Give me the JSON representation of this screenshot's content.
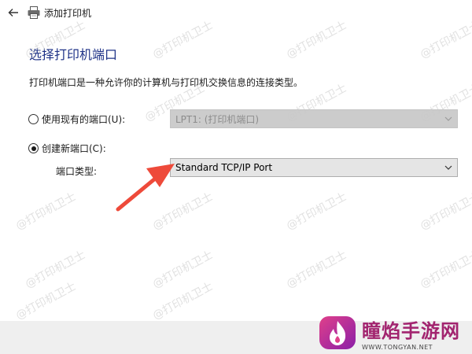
{
  "window": {
    "title": "添加打印机",
    "back_icon": "back-arrow-icon",
    "app_icon": "printer-icon"
  },
  "page": {
    "heading": "选择打印机端口",
    "description": "打印机端口是一种允许你的计算机与打印机交换信息的连接类型。"
  },
  "existing_port": {
    "label": "使用现有的端口(U):",
    "selected": false,
    "dropdown_value": "LPT1: (打印机端口)",
    "enabled": false
  },
  "new_port": {
    "label": "创建新端口(C):",
    "selected": true,
    "type_label": "端口类型:",
    "dropdown_value": "Standard TCP/IP Port",
    "enabled": true
  },
  "watermark": {
    "text": "@打印机卫士"
  },
  "brand": {
    "name": "瞳焰手游网",
    "url": "WWW.TONGYAN.NET"
  },
  "colors": {
    "heading": "#1e3287",
    "annotation_arrow": "#ee4a3a",
    "brand": "#a2246f",
    "footer": "#efefef"
  }
}
